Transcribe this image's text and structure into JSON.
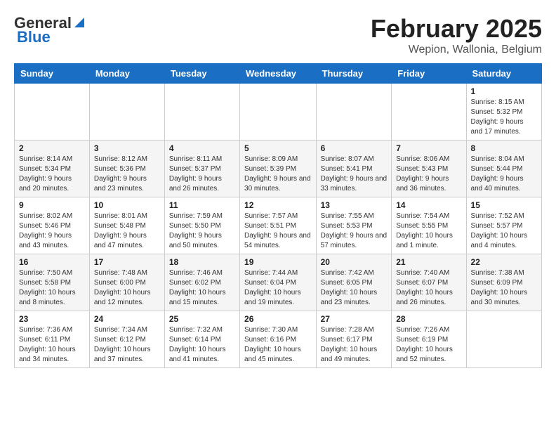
{
  "header": {
    "logo_general": "General",
    "logo_blue": "Blue",
    "title": "February 2025",
    "subtitle": "Wepion, Wallonia, Belgium"
  },
  "calendar": {
    "days_of_week": [
      "Sunday",
      "Monday",
      "Tuesday",
      "Wednesday",
      "Thursday",
      "Friday",
      "Saturday"
    ],
    "weeks": [
      [
        {
          "day": "",
          "info": ""
        },
        {
          "day": "",
          "info": ""
        },
        {
          "day": "",
          "info": ""
        },
        {
          "day": "",
          "info": ""
        },
        {
          "day": "",
          "info": ""
        },
        {
          "day": "",
          "info": ""
        },
        {
          "day": "1",
          "info": "Sunrise: 8:15 AM\nSunset: 5:32 PM\nDaylight: 9 hours and 17 minutes."
        }
      ],
      [
        {
          "day": "2",
          "info": "Sunrise: 8:14 AM\nSunset: 5:34 PM\nDaylight: 9 hours and 20 minutes."
        },
        {
          "day": "3",
          "info": "Sunrise: 8:12 AM\nSunset: 5:36 PM\nDaylight: 9 hours and 23 minutes."
        },
        {
          "day": "4",
          "info": "Sunrise: 8:11 AM\nSunset: 5:37 PM\nDaylight: 9 hours and 26 minutes."
        },
        {
          "day": "5",
          "info": "Sunrise: 8:09 AM\nSunset: 5:39 PM\nDaylight: 9 hours and 30 minutes."
        },
        {
          "day": "6",
          "info": "Sunrise: 8:07 AM\nSunset: 5:41 PM\nDaylight: 9 hours and 33 minutes."
        },
        {
          "day": "7",
          "info": "Sunrise: 8:06 AM\nSunset: 5:43 PM\nDaylight: 9 hours and 36 minutes."
        },
        {
          "day": "8",
          "info": "Sunrise: 8:04 AM\nSunset: 5:44 PM\nDaylight: 9 hours and 40 minutes."
        }
      ],
      [
        {
          "day": "9",
          "info": "Sunrise: 8:02 AM\nSunset: 5:46 PM\nDaylight: 9 hours and 43 minutes."
        },
        {
          "day": "10",
          "info": "Sunrise: 8:01 AM\nSunset: 5:48 PM\nDaylight: 9 hours and 47 minutes."
        },
        {
          "day": "11",
          "info": "Sunrise: 7:59 AM\nSunset: 5:50 PM\nDaylight: 9 hours and 50 minutes."
        },
        {
          "day": "12",
          "info": "Sunrise: 7:57 AM\nSunset: 5:51 PM\nDaylight: 9 hours and 54 minutes."
        },
        {
          "day": "13",
          "info": "Sunrise: 7:55 AM\nSunset: 5:53 PM\nDaylight: 9 hours and 57 minutes."
        },
        {
          "day": "14",
          "info": "Sunrise: 7:54 AM\nSunset: 5:55 PM\nDaylight: 10 hours and 1 minute."
        },
        {
          "day": "15",
          "info": "Sunrise: 7:52 AM\nSunset: 5:57 PM\nDaylight: 10 hours and 4 minutes."
        }
      ],
      [
        {
          "day": "16",
          "info": "Sunrise: 7:50 AM\nSunset: 5:58 PM\nDaylight: 10 hours and 8 minutes."
        },
        {
          "day": "17",
          "info": "Sunrise: 7:48 AM\nSunset: 6:00 PM\nDaylight: 10 hours and 12 minutes."
        },
        {
          "day": "18",
          "info": "Sunrise: 7:46 AM\nSunset: 6:02 PM\nDaylight: 10 hours and 15 minutes."
        },
        {
          "day": "19",
          "info": "Sunrise: 7:44 AM\nSunset: 6:04 PM\nDaylight: 10 hours and 19 minutes."
        },
        {
          "day": "20",
          "info": "Sunrise: 7:42 AM\nSunset: 6:05 PM\nDaylight: 10 hours and 23 minutes."
        },
        {
          "day": "21",
          "info": "Sunrise: 7:40 AM\nSunset: 6:07 PM\nDaylight: 10 hours and 26 minutes."
        },
        {
          "day": "22",
          "info": "Sunrise: 7:38 AM\nSunset: 6:09 PM\nDaylight: 10 hours and 30 minutes."
        }
      ],
      [
        {
          "day": "23",
          "info": "Sunrise: 7:36 AM\nSunset: 6:11 PM\nDaylight: 10 hours and 34 minutes."
        },
        {
          "day": "24",
          "info": "Sunrise: 7:34 AM\nSunset: 6:12 PM\nDaylight: 10 hours and 37 minutes."
        },
        {
          "day": "25",
          "info": "Sunrise: 7:32 AM\nSunset: 6:14 PM\nDaylight: 10 hours and 41 minutes."
        },
        {
          "day": "26",
          "info": "Sunrise: 7:30 AM\nSunset: 6:16 PM\nDaylight: 10 hours and 45 minutes."
        },
        {
          "day": "27",
          "info": "Sunrise: 7:28 AM\nSunset: 6:17 PM\nDaylight: 10 hours and 49 minutes."
        },
        {
          "day": "28",
          "info": "Sunrise: 7:26 AM\nSunset: 6:19 PM\nDaylight: 10 hours and 52 minutes."
        },
        {
          "day": "",
          "info": ""
        }
      ]
    ]
  }
}
